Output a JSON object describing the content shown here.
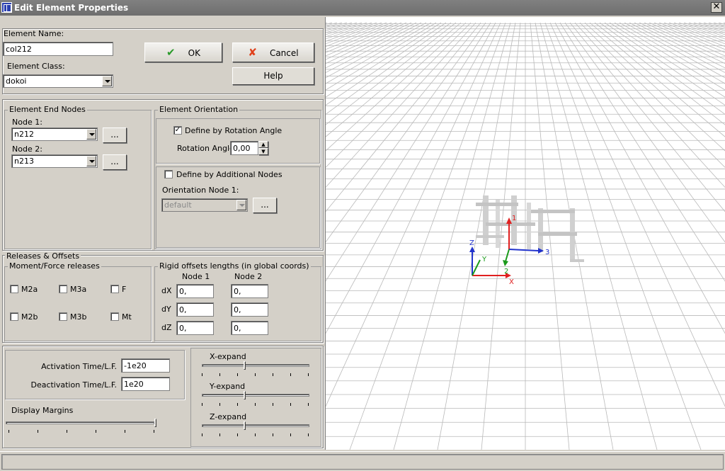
{
  "window": {
    "title": "Edit Element Properties",
    "close_glyph": "✕"
  },
  "element": {
    "name_label": "Element Name:",
    "name_value": "col212",
    "class_label": "Element Class:",
    "class_value": "dokoi"
  },
  "buttons": {
    "ok": "OK",
    "cancel": "Cancel",
    "help": "Help",
    "browse": "..."
  },
  "end_nodes": {
    "title": "Element End Nodes",
    "node1_label": "Node 1:",
    "node1_value": "n212",
    "node2_label": "Node 2:",
    "node2_value": "n213"
  },
  "orientation": {
    "title": "Element Orientation",
    "by_angle_label": "Define by Rotation Angle",
    "by_angle_checked": true,
    "rotation_angle_label": "Rotation Angle",
    "rotation_angle_value": "0,00",
    "by_nodes_label": "Define by Additional Nodes",
    "by_nodes_checked": false,
    "orient_node_label": "Orientation Node 1:",
    "orient_node_value": "default"
  },
  "releases": {
    "title": "Releases & Offsets",
    "moment_title": "Moment/Force releases",
    "items": [
      "M2a",
      "M3a",
      "F",
      "M2b",
      "M3b",
      "Mt"
    ],
    "rigid_title": "Rigid offsets lengths (in global coords)",
    "node1_header": "Node 1",
    "node2_header": "Node 2",
    "rows": [
      {
        "label": "dX",
        "node1": "0,",
        "node2": "0,"
      },
      {
        "label": "dY",
        "node1": "0,",
        "node2": "0,"
      },
      {
        "label": "dZ",
        "node1": "0,",
        "node2": "0,"
      }
    ]
  },
  "time": {
    "activation_label": "Activation Time/L.F.",
    "activation_value": "-1e20",
    "deactivation_label": "Deactivation Time/L.F.",
    "deactivation_value": "1e20"
  },
  "margins": {
    "label": "Display Margins"
  },
  "expand": {
    "x_label": "X-expand",
    "y_label": "Y-expand",
    "z_label": "Z-expand"
  },
  "viewport": {
    "axis_labels": {
      "x": "X",
      "y": "Y",
      "z": "Z",
      "one": "1",
      "two": "2",
      "three": "3"
    },
    "colors": {
      "grid": "#b9b9b9",
      "x_axis": "#e02020",
      "y_axis": "#1a9a1a",
      "z_axis": "#2233cc",
      "model": "#c8c8c8"
    }
  }
}
